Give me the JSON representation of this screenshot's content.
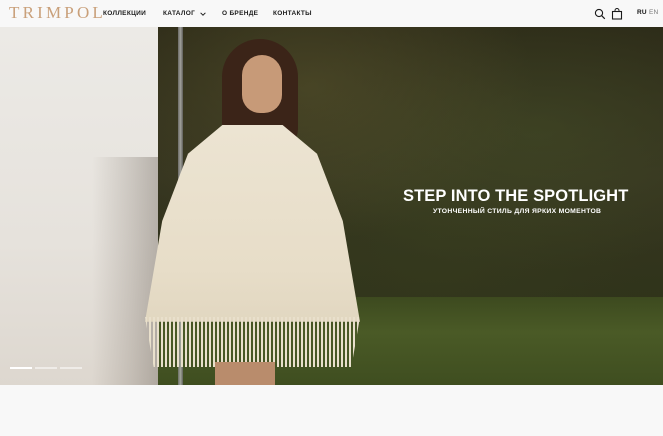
{
  "brand": {
    "logo_text": "TRIMPOL",
    "accent_color": "#c9a07a"
  },
  "nav": {
    "items": [
      {
        "label": "КОЛЛЕКЦИИ"
      },
      {
        "label": "КАТАЛОГ",
        "has_dropdown": true
      },
      {
        "label": "О БРЕНДЕ"
      },
      {
        "label": "КОНТАКТЫ"
      }
    ]
  },
  "header_icons": {
    "search": "search-icon",
    "bag": "shopping-bag-icon"
  },
  "languages": {
    "ru": "RU",
    "en": "EN",
    "active": "RU"
  },
  "hero": {
    "headline": "STEP INTO THE SPOTLIGHT",
    "subline": "УТОНЧЕННЫЙ СТИЛЬ ДЛЯ ЯРКИХ МОМЕНТОВ",
    "slides": {
      "count": 3,
      "active_index": 0
    }
  }
}
